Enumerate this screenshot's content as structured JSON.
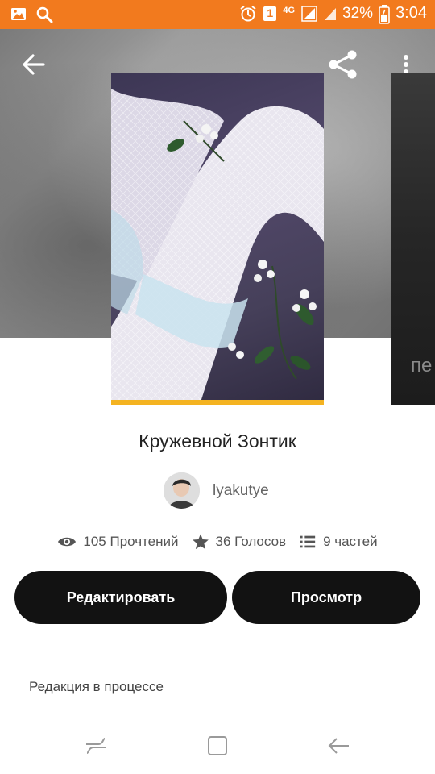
{
  "status_bar": {
    "time": "3:04",
    "battery": "32%",
    "network": "4G",
    "sim": "1",
    "icons": [
      "image-icon",
      "search-icon",
      "alarm-icon",
      "sim-icon",
      "signal-icon",
      "battery-icon"
    ]
  },
  "toolbar": {
    "back_icon": "arrow-left-icon",
    "share_icon": "share-icon",
    "more_icon": "more-vertical-icon"
  },
  "story": {
    "title": "Кружевной Зонтик",
    "author": "lyakutye",
    "next_cover_text": "пе"
  },
  "stats": {
    "reads": "105 Прочтений",
    "votes": "36 Голосов",
    "parts": "9 частей"
  },
  "actions": {
    "edit_label": "Редактировать",
    "view_label": "Просмотр"
  },
  "status_text": "Редакция в процессе",
  "navbar": {
    "icons": [
      "recent-apps-icon",
      "home-icon",
      "back-icon"
    ]
  },
  "colors": {
    "status_bar": "#f27a1e",
    "button": "#121212",
    "cover_accent": "#f4b321"
  }
}
